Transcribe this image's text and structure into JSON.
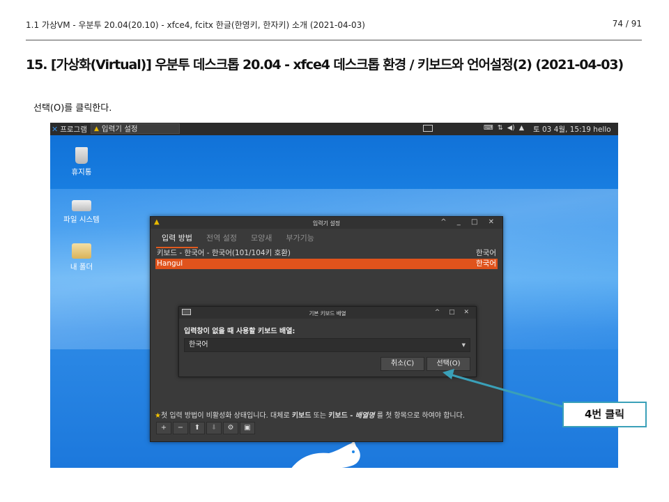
{
  "header": {
    "doc_title": "1.1 가상VM - 우분투 20.04(20.10) - xfce4, fcitx 한글(한영키, 한자키) 소개 (2021-04-03)",
    "page_number": "74 / 91"
  },
  "section_title": "15. [가상화(Virtual)] 우분투 데스크톱 20.04 - xfce4 데스크톱 환경 / 키보드와 언어설정(2) (2021-04-03)",
  "instruction": "선택(O)를 클릭한다.",
  "panel": {
    "menu_label": "프로그램",
    "task_label": "입력기 설정",
    "clock": "토 03  4월, 15:19  hello"
  },
  "desktop_icons": [
    {
      "label": "휴지통",
      "icon": "trash-icon"
    },
    {
      "label": "파일 시스템",
      "icon": "drive-icon"
    },
    {
      "label": "내 폴더",
      "icon": "home-folder-icon"
    }
  ],
  "input_window": {
    "title": "입력기 설정",
    "tabs": [
      "입력 방법",
      "전역 설정",
      "모양새",
      "부가기능"
    ],
    "rows": [
      {
        "name": "키보드 - 한국어 - 한국어(101/104키 호환)",
        "lang": "한국어"
      },
      {
        "name": "Hangul",
        "lang": "한국어"
      }
    ],
    "hint_text": {
      "a": "첫 입력 방법이 비활성화 상태입니다. 대체로 ",
      "b": "키보드",
      "c": " 또는 ",
      "d": "키보드 - ",
      "e": "배열명",
      "f": " 를 첫 항목으로 하여야 합니다."
    },
    "toolbar": [
      "+",
      "−",
      "⬆",
      "⬇",
      "⚙",
      "▣"
    ]
  },
  "dialog": {
    "title": "기본 키보드 배열",
    "label": "입력창이 없을 때 사용할 키보드 배열:",
    "combo_value": "한국어",
    "cancel_label": "취소(C)",
    "ok_label": "선택(O)"
  },
  "callout": "4번 클릭",
  "colors": {
    "accent_orange": "#e0531c",
    "callout_teal": "#3aa0b8",
    "desktop_blue": "#1e86e6"
  }
}
